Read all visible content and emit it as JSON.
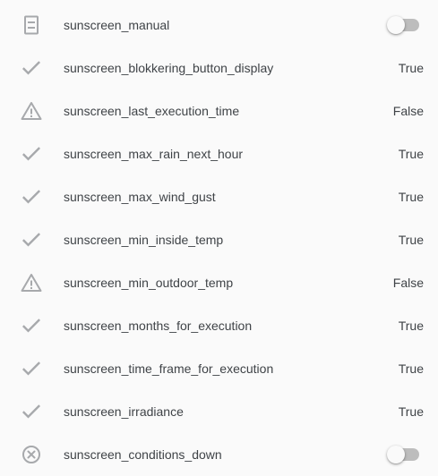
{
  "entities": [
    {
      "name": "sunscreen_manual",
      "icon": "switch-device-icon",
      "type": "toggle",
      "state": "off"
    },
    {
      "name": "sunscreen_blokkering_button_display",
      "icon": "check-icon",
      "type": "value",
      "value": "True"
    },
    {
      "name": "sunscreen_last_execution_time",
      "icon": "warning-icon",
      "type": "value",
      "value": "False"
    },
    {
      "name": "sunscreen_max_rain_next_hour",
      "icon": "check-icon",
      "type": "value",
      "value": "True"
    },
    {
      "name": "sunscreen_max_wind_gust",
      "icon": "check-icon",
      "type": "value",
      "value": "True"
    },
    {
      "name": "sunscreen_min_inside_temp",
      "icon": "check-icon",
      "type": "value",
      "value": "True"
    },
    {
      "name": "sunscreen_min_outdoor_temp",
      "icon": "warning-icon",
      "type": "value",
      "value": "False"
    },
    {
      "name": "sunscreen_months_for_execution",
      "icon": "check-icon",
      "type": "value",
      "value": "True"
    },
    {
      "name": "sunscreen_time_frame_for_execution",
      "icon": "check-icon",
      "type": "value",
      "value": "True"
    },
    {
      "name": "sunscreen_irradiance",
      "icon": "check-icon",
      "type": "value",
      "value": "True"
    },
    {
      "name": "sunscreen_conditions_down",
      "icon": "close-circle-icon",
      "type": "toggle",
      "state": "off"
    }
  ],
  "colors": {
    "icon": "#a7a9ac",
    "text": "#3f4347",
    "toggle_track": "#bdbdbd",
    "toggle_thumb": "#fafafa",
    "background": "#fafafa"
  }
}
